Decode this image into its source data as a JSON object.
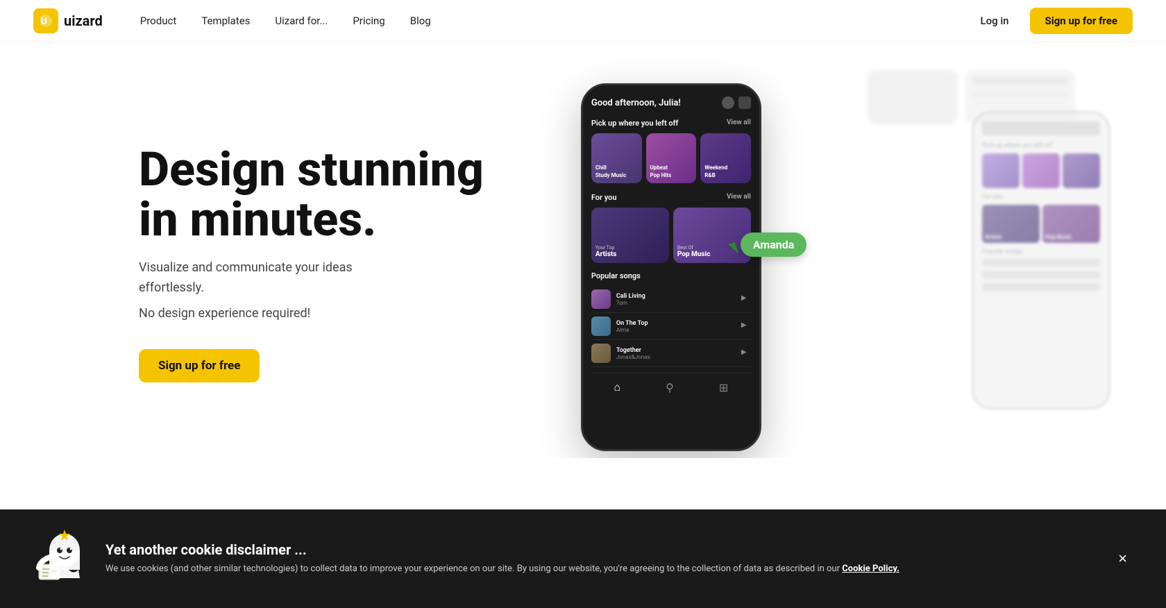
{
  "nav": {
    "logo_text": "uizard",
    "links": [
      {
        "id": "product",
        "label": "Product"
      },
      {
        "id": "templates",
        "label": "Templates"
      },
      {
        "id": "uizard-for",
        "label": "Uizard for..."
      },
      {
        "id": "pricing",
        "label": "Pricing"
      },
      {
        "id": "blog",
        "label": "Blog"
      }
    ],
    "login_label": "Log in",
    "signup_label": "Sign up for free"
  },
  "hero": {
    "headline_line1": "Design stunning",
    "headline_line2": "in minutes.",
    "sub1": "Visualize and communicate your ideas",
    "sub1b": "effortlessly.",
    "sub2": "No design experience required!",
    "cta": "Sign up for free"
  },
  "phone": {
    "greeting": "Good afternoon, Julia!",
    "pick_up_section": "Pick up where you left off",
    "view_all": "View all",
    "cards": [
      {
        "line1": "Chill",
        "line2": "Study Music"
      },
      {
        "line1": "Upbeat",
        "line2": "Pop Hits"
      },
      {
        "line1": "Weekend",
        "line2": "R&B"
      }
    ],
    "for_you": "For you",
    "fy_cards": [
      {
        "sub": "Your Top",
        "main": "Artists"
      },
      {
        "sub": "Best Of",
        "main": "Pop Music"
      }
    ],
    "popular_songs": "Popular songs",
    "songs": [
      {
        "name": "Cali Living",
        "artist": "Tom"
      },
      {
        "name": "On The Top",
        "artist": "Alma"
      },
      {
        "name": "Together",
        "artist": "Jonas&Jonas"
      }
    ]
  },
  "amanda": {
    "label": "Amanda"
  },
  "cookie": {
    "title": "Yet another cookie disclaimer ...",
    "text": "We use cookies (and other similar technologies) to collect data to improve your experience on our site. By using our website, you're agreeing to the collection of data as described in our ",
    "link_text": "Cookie Policy.",
    "close_label": "×"
  }
}
